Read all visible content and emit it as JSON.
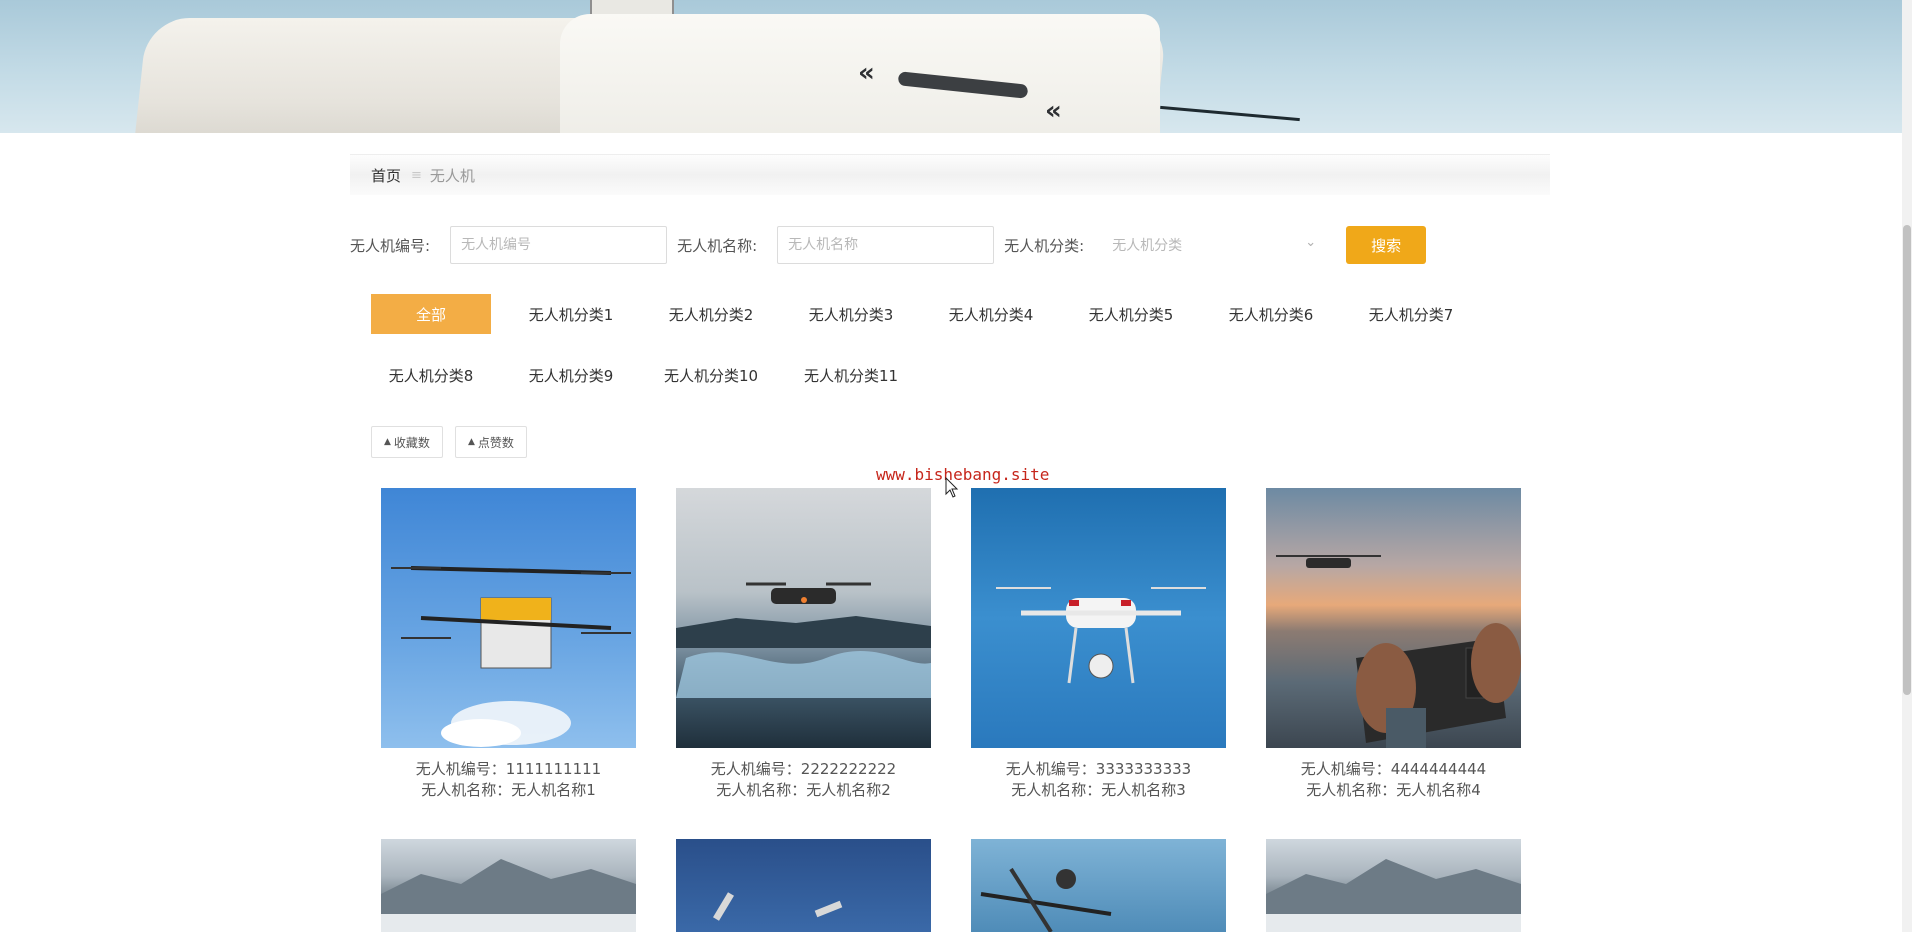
{
  "breadcrumb": {
    "home": "首页",
    "separator": "≡",
    "current": "无人机"
  },
  "search": {
    "code_label": "无人机编号:",
    "code_placeholder": "无人机编号",
    "name_label": "无人机名称:",
    "name_placeholder": "无人机名称",
    "category_label": "无人机分类:",
    "category_placeholder": "无人机分类",
    "button": "搜索"
  },
  "categories": [
    "全部",
    "无人机分类1",
    "无人机分类2",
    "无人机分类3",
    "无人机分类4",
    "无人机分类5",
    "无人机分类6",
    "无人机分类7",
    "无人机分类8",
    "无人机分类9",
    "无人机分类10",
    "无人机分类11"
  ],
  "sort_buttons": [
    "收藏数",
    "点赞数"
  ],
  "watermark": "www.bishebang.site",
  "products": [
    {
      "code_label": "无人机编号：",
      "code": "1111111111",
      "name_label": "无人机名称：",
      "name": "无人机名称1"
    },
    {
      "code_label": "无人机编号：",
      "code": "2222222222",
      "name_label": "无人机名称：",
      "name": "无人机名称2"
    },
    {
      "code_label": "无人机编号：",
      "code": "3333333333",
      "name_label": "无人机名称：",
      "name": "无人机名称3"
    },
    {
      "code_label": "无人机编号：",
      "code": "4444444444",
      "name_label": "无人机名称：",
      "name": "无人机名称4"
    }
  ],
  "colors": {
    "accent": "#f0a819",
    "category_active": "#f3ad45",
    "watermark": "#c6261b"
  }
}
